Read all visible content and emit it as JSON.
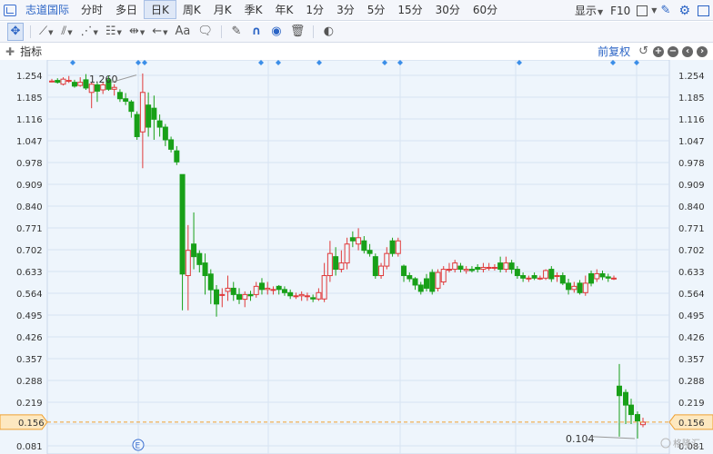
{
  "topbar": {
    "stock_name": "志道国际",
    "periods": [
      "分时",
      "多日",
      "日K",
      "周K",
      "月K",
      "季K",
      "年K",
      "1分",
      "3分",
      "5分",
      "15分",
      "30分",
      "60分"
    ],
    "active_period": "日K",
    "display_label": "显示",
    "f10_label": "F10"
  },
  "toolbar": {
    "text_tool_label": "Aa"
  },
  "indicator_bar": {
    "label": "指标",
    "adjust_label": "前复权"
  },
  "chart_data": {
    "type": "candlestick",
    "y_ticks": [
      "1.254",
      "1.185",
      "1.116",
      "1.047",
      "0.978",
      "0.909",
      "0.840",
      "0.771",
      "0.702",
      "0.633",
      "0.564",
      "0.495",
      "0.426",
      "0.357",
      "0.288",
      "0.219",
      "0.150",
      "0.081"
    ],
    "ylim": [
      0.081,
      1.254
    ],
    "current_price": "0.156",
    "annotations": {
      "high": "1.260",
      "low": "0.104"
    },
    "event_marker": "E",
    "watermark": "格隆汇",
    "candles": [
      {
        "o": 1.236,
        "c": 1.236,
        "h": 1.243,
        "l": 1.232
      },
      {
        "o": 1.238,
        "c": 1.232,
        "h": 1.245,
        "l": 1.228
      },
      {
        "o": 1.226,
        "c": 1.242,
        "h": 1.248,
        "l": 1.222
      },
      {
        "o": 1.238,
        "c": 1.238,
        "h": 1.252,
        "l": 1.23
      },
      {
        "o": 1.232,
        "c": 1.22,
        "h": 1.24,
        "l": 1.215
      },
      {
        "o": 1.222,
        "c": 1.232,
        "h": 1.248,
        "l": 1.218
      },
      {
        "o": 1.24,
        "c": 1.214,
        "h": 1.258,
        "l": 1.208
      },
      {
        "o": 1.2,
        "c": 1.226,
        "h": 1.232,
        "l": 1.15
      },
      {
        "o": 1.224,
        "c": 1.204,
        "h": 1.232,
        "l": 1.17
      },
      {
        "o": 1.208,
        "c": 1.224,
        "h": 1.233,
        "l": 1.195
      },
      {
        "o": 1.24,
        "c": 1.21,
        "h": 1.252,
        "l": 1.205
      },
      {
        "o": 1.21,
        "c": 1.216,
        "h": 1.226,
        "l": 1.19
      },
      {
        "o": 1.2,
        "c": 1.18,
        "h": 1.21,
        "l": 1.17
      },
      {
        "o": 1.18,
        "c": 1.172,
        "h": 1.198,
        "l": 1.16
      },
      {
        "o": 1.17,
        "c": 1.14,
        "h": 1.176,
        "l": 1.12
      },
      {
        "o": 1.13,
        "c": 1.06,
        "h": 1.14,
        "l": 1.05
      },
      {
        "o": 1.075,
        "c": 1.2,
        "h": 1.26,
        "l": 0.96
      },
      {
        "o": 1.16,
        "c": 1.09,
        "h": 1.2,
        "l": 1.06
      },
      {
        "o": 1.15,
        "c": 1.115,
        "h": 1.19,
        "l": 1.05
      },
      {
        "o": 1.11,
        "c": 1.09,
        "h": 1.13,
        "l": 1.06
      },
      {
        "o": 1.09,
        "c": 1.05,
        "h": 1.1,
        "l": 1.03
      },
      {
        "o": 1.05,
        "c": 1.02,
        "h": 1.06,
        "l": 1.01
      },
      {
        "o": 1.015,
        "c": 0.98,
        "h": 1.03,
        "l": 0.97
      },
      {
        "o": 0.94,
        "c": 0.625,
        "h": 0.94,
        "l": 0.51
      },
      {
        "o": 0.62,
        "c": 0.7,
        "h": 0.78,
        "l": 0.51
      },
      {
        "o": 0.72,
        "c": 0.68,
        "h": 0.82,
        "l": 0.64
      },
      {
        "o": 0.69,
        "c": 0.655,
        "h": 0.7,
        "l": 0.63
      },
      {
        "o": 0.66,
        "c": 0.62,
        "h": 0.69,
        "l": 0.56
      },
      {
        "o": 0.625,
        "c": 0.575,
        "h": 0.64,
        "l": 0.53
      },
      {
        "o": 0.575,
        "c": 0.53,
        "h": 0.59,
        "l": 0.49
      },
      {
        "o": 0.56,
        "c": 0.56,
        "h": 0.58,
        "l": 0.52
      },
      {
        "o": 0.57,
        "c": 0.58,
        "h": 0.62,
        "l": 0.54
      },
      {
        "o": 0.58,
        "c": 0.56,
        "h": 0.6,
        "l": 0.54
      },
      {
        "o": 0.56,
        "c": 0.545,
        "h": 0.58,
        "l": 0.53
      },
      {
        "o": 0.545,
        "c": 0.56,
        "h": 0.57,
        "l": 0.52
      },
      {
        "o": 0.56,
        "c": 0.556,
        "h": 0.572,
        "l": 0.54
      },
      {
        "o": 0.56,
        "c": 0.586,
        "h": 0.6,
        "l": 0.55
      },
      {
        "o": 0.596,
        "c": 0.576,
        "h": 0.612,
        "l": 0.56
      },
      {
        "o": 0.576,
        "c": 0.58,
        "h": 0.6,
        "l": 0.56
      },
      {
        "o": 0.576,
        "c": 0.576,
        "h": 0.586,
        "l": 0.56
      },
      {
        "o": 0.586,
        "c": 0.576,
        "h": 0.59,
        "l": 0.56
      },
      {
        "o": 0.576,
        "c": 0.566,
        "h": 0.586,
        "l": 0.556
      },
      {
        "o": 0.566,
        "c": 0.556,
        "h": 0.576,
        "l": 0.546
      },
      {
        "o": 0.556,
        "c": 0.556,
        "h": 0.566,
        "l": 0.546
      },
      {
        "o": 0.556,
        "c": 0.56,
        "h": 0.57,
        "l": 0.54
      },
      {
        "o": 0.556,
        "c": 0.556,
        "h": 0.566,
        "l": 0.54
      },
      {
        "o": 0.55,
        "c": 0.546,
        "h": 0.56,
        "l": 0.536
      },
      {
        "o": 0.546,
        "c": 0.566,
        "h": 0.58,
        "l": 0.54
      },
      {
        "o": 0.546,
        "c": 0.62,
        "h": 0.66,
        "l": 0.536
      },
      {
        "o": 0.62,
        "c": 0.69,
        "h": 0.73,
        "l": 0.6
      },
      {
        "o": 0.68,
        "c": 0.64,
        "h": 0.71,
        "l": 0.62
      },
      {
        "o": 0.64,
        "c": 0.66,
        "h": 0.7,
        "l": 0.63
      },
      {
        "o": 0.66,
        "c": 0.72,
        "h": 0.74,
        "l": 0.64
      },
      {
        "o": 0.74,
        "c": 0.73,
        "h": 0.76,
        "l": 0.71
      },
      {
        "o": 0.72,
        "c": 0.74,
        "h": 0.77,
        "l": 0.7
      },
      {
        "o": 0.73,
        "c": 0.7,
        "h": 0.745,
        "l": 0.69
      },
      {
        "o": 0.7,
        "c": 0.69,
        "h": 0.72,
        "l": 0.68
      },
      {
        "o": 0.68,
        "c": 0.62,
        "h": 0.69,
        "l": 0.61
      },
      {
        "o": 0.62,
        "c": 0.65,
        "h": 0.66,
        "l": 0.61
      },
      {
        "o": 0.65,
        "c": 0.69,
        "h": 0.71,
        "l": 0.64
      },
      {
        "o": 0.73,
        "c": 0.69,
        "h": 0.74,
        "l": 0.68
      },
      {
        "o": 0.69,
        "c": 0.73,
        "h": 0.74,
        "l": 0.68
      },
      {
        "o": 0.65,
        "c": 0.62,
        "h": 0.655,
        "l": 0.6
      },
      {
        "o": 0.62,
        "c": 0.61,
        "h": 0.63,
        "l": 0.6
      },
      {
        "o": 0.61,
        "c": 0.59,
        "h": 0.615,
        "l": 0.575
      },
      {
        "o": 0.59,
        "c": 0.57,
        "h": 0.6,
        "l": 0.56
      },
      {
        "o": 0.61,
        "c": 0.58,
        "h": 0.625,
        "l": 0.57
      },
      {
        "o": 0.63,
        "c": 0.57,
        "h": 0.64,
        "l": 0.56
      },
      {
        "o": 0.58,
        "c": 0.63,
        "h": 0.64,
        "l": 0.57
      },
      {
        "o": 0.6,
        "c": 0.64,
        "h": 0.65,
        "l": 0.59
      },
      {
        "o": 0.64,
        "c": 0.64,
        "h": 0.66,
        "l": 0.63
      },
      {
        "o": 0.64,
        "c": 0.66,
        "h": 0.67,
        "l": 0.63
      },
      {
        "o": 0.65,
        "c": 0.64,
        "h": 0.66,
        "l": 0.63
      },
      {
        "o": 0.636,
        "c": 0.64,
        "h": 0.65,
        "l": 0.626
      },
      {
        "o": 0.64,
        "c": 0.636,
        "h": 0.65,
        "l": 0.63
      },
      {
        "o": 0.646,
        "c": 0.64,
        "h": 0.656,
        "l": 0.63
      },
      {
        "o": 0.64,
        "c": 0.646,
        "h": 0.66,
        "l": 0.63
      },
      {
        "o": 0.646,
        "c": 0.646,
        "h": 0.66,
        "l": 0.636
      },
      {
        "o": 0.646,
        "c": 0.646,
        "h": 0.656,
        "l": 0.636
      },
      {
        "o": 0.66,
        "c": 0.64,
        "h": 0.68,
        "l": 0.63
      },
      {
        "o": 0.64,
        "c": 0.66,
        "h": 0.68,
        "l": 0.63
      },
      {
        "o": 0.66,
        "c": 0.64,
        "h": 0.67,
        "l": 0.626
      },
      {
        "o": 0.64,
        "c": 0.62,
        "h": 0.65,
        "l": 0.61
      },
      {
        "o": 0.62,
        "c": 0.612,
        "h": 0.63,
        "l": 0.6
      },
      {
        "o": 0.612,
        "c": 0.612,
        "h": 0.62,
        "l": 0.6
      },
      {
        "o": 0.62,
        "c": 0.612,
        "h": 0.63,
        "l": 0.606
      },
      {
        "o": 0.612,
        "c": 0.612,
        "h": 0.62,
        "l": 0.606
      },
      {
        "o": 0.612,
        "c": 0.636,
        "h": 0.64,
        "l": 0.606
      },
      {
        "o": 0.64,
        "c": 0.61,
        "h": 0.65,
        "l": 0.6
      },
      {
        "o": 0.62,
        "c": 0.62,
        "h": 0.63,
        "l": 0.6
      },
      {
        "o": 0.62,
        "c": 0.596,
        "h": 0.63,
        "l": 0.59
      },
      {
        "o": 0.596,
        "c": 0.576,
        "h": 0.61,
        "l": 0.56
      },
      {
        "o": 0.576,
        "c": 0.586,
        "h": 0.6,
        "l": 0.566
      },
      {
        "o": 0.596,
        "c": 0.566,
        "h": 0.606,
        "l": 0.56
      },
      {
        "o": 0.566,
        "c": 0.596,
        "h": 0.62,
        "l": 0.556
      },
      {
        "o": 0.626,
        "c": 0.596,
        "h": 0.636,
        "l": 0.586
      },
      {
        "o": 0.61,
        "c": 0.626,
        "h": 0.64,
        "l": 0.6
      },
      {
        "o": 0.626,
        "c": 0.616,
        "h": 0.636,
        "l": 0.606
      },
      {
        "o": 0.616,
        "c": 0.612,
        "h": 0.626,
        "l": 0.6
      },
      {
        "o": 0.612,
        "c": 0.612,
        "h": 0.62,
        "l": 0.606
      },
      {
        "o": 0.27,
        "c": 0.24,
        "h": 0.34,
        "l": 0.11
      },
      {
        "o": 0.25,
        "c": 0.21,
        "h": 0.26,
        "l": 0.15
      },
      {
        "o": 0.21,
        "c": 0.18,
        "h": 0.23,
        "l": 0.15
      },
      {
        "o": 0.18,
        "c": 0.16,
        "h": 0.19,
        "l": 0.104
      },
      {
        "o": 0.148,
        "c": 0.156,
        "h": 0.17,
        "l": 0.14
      }
    ]
  }
}
